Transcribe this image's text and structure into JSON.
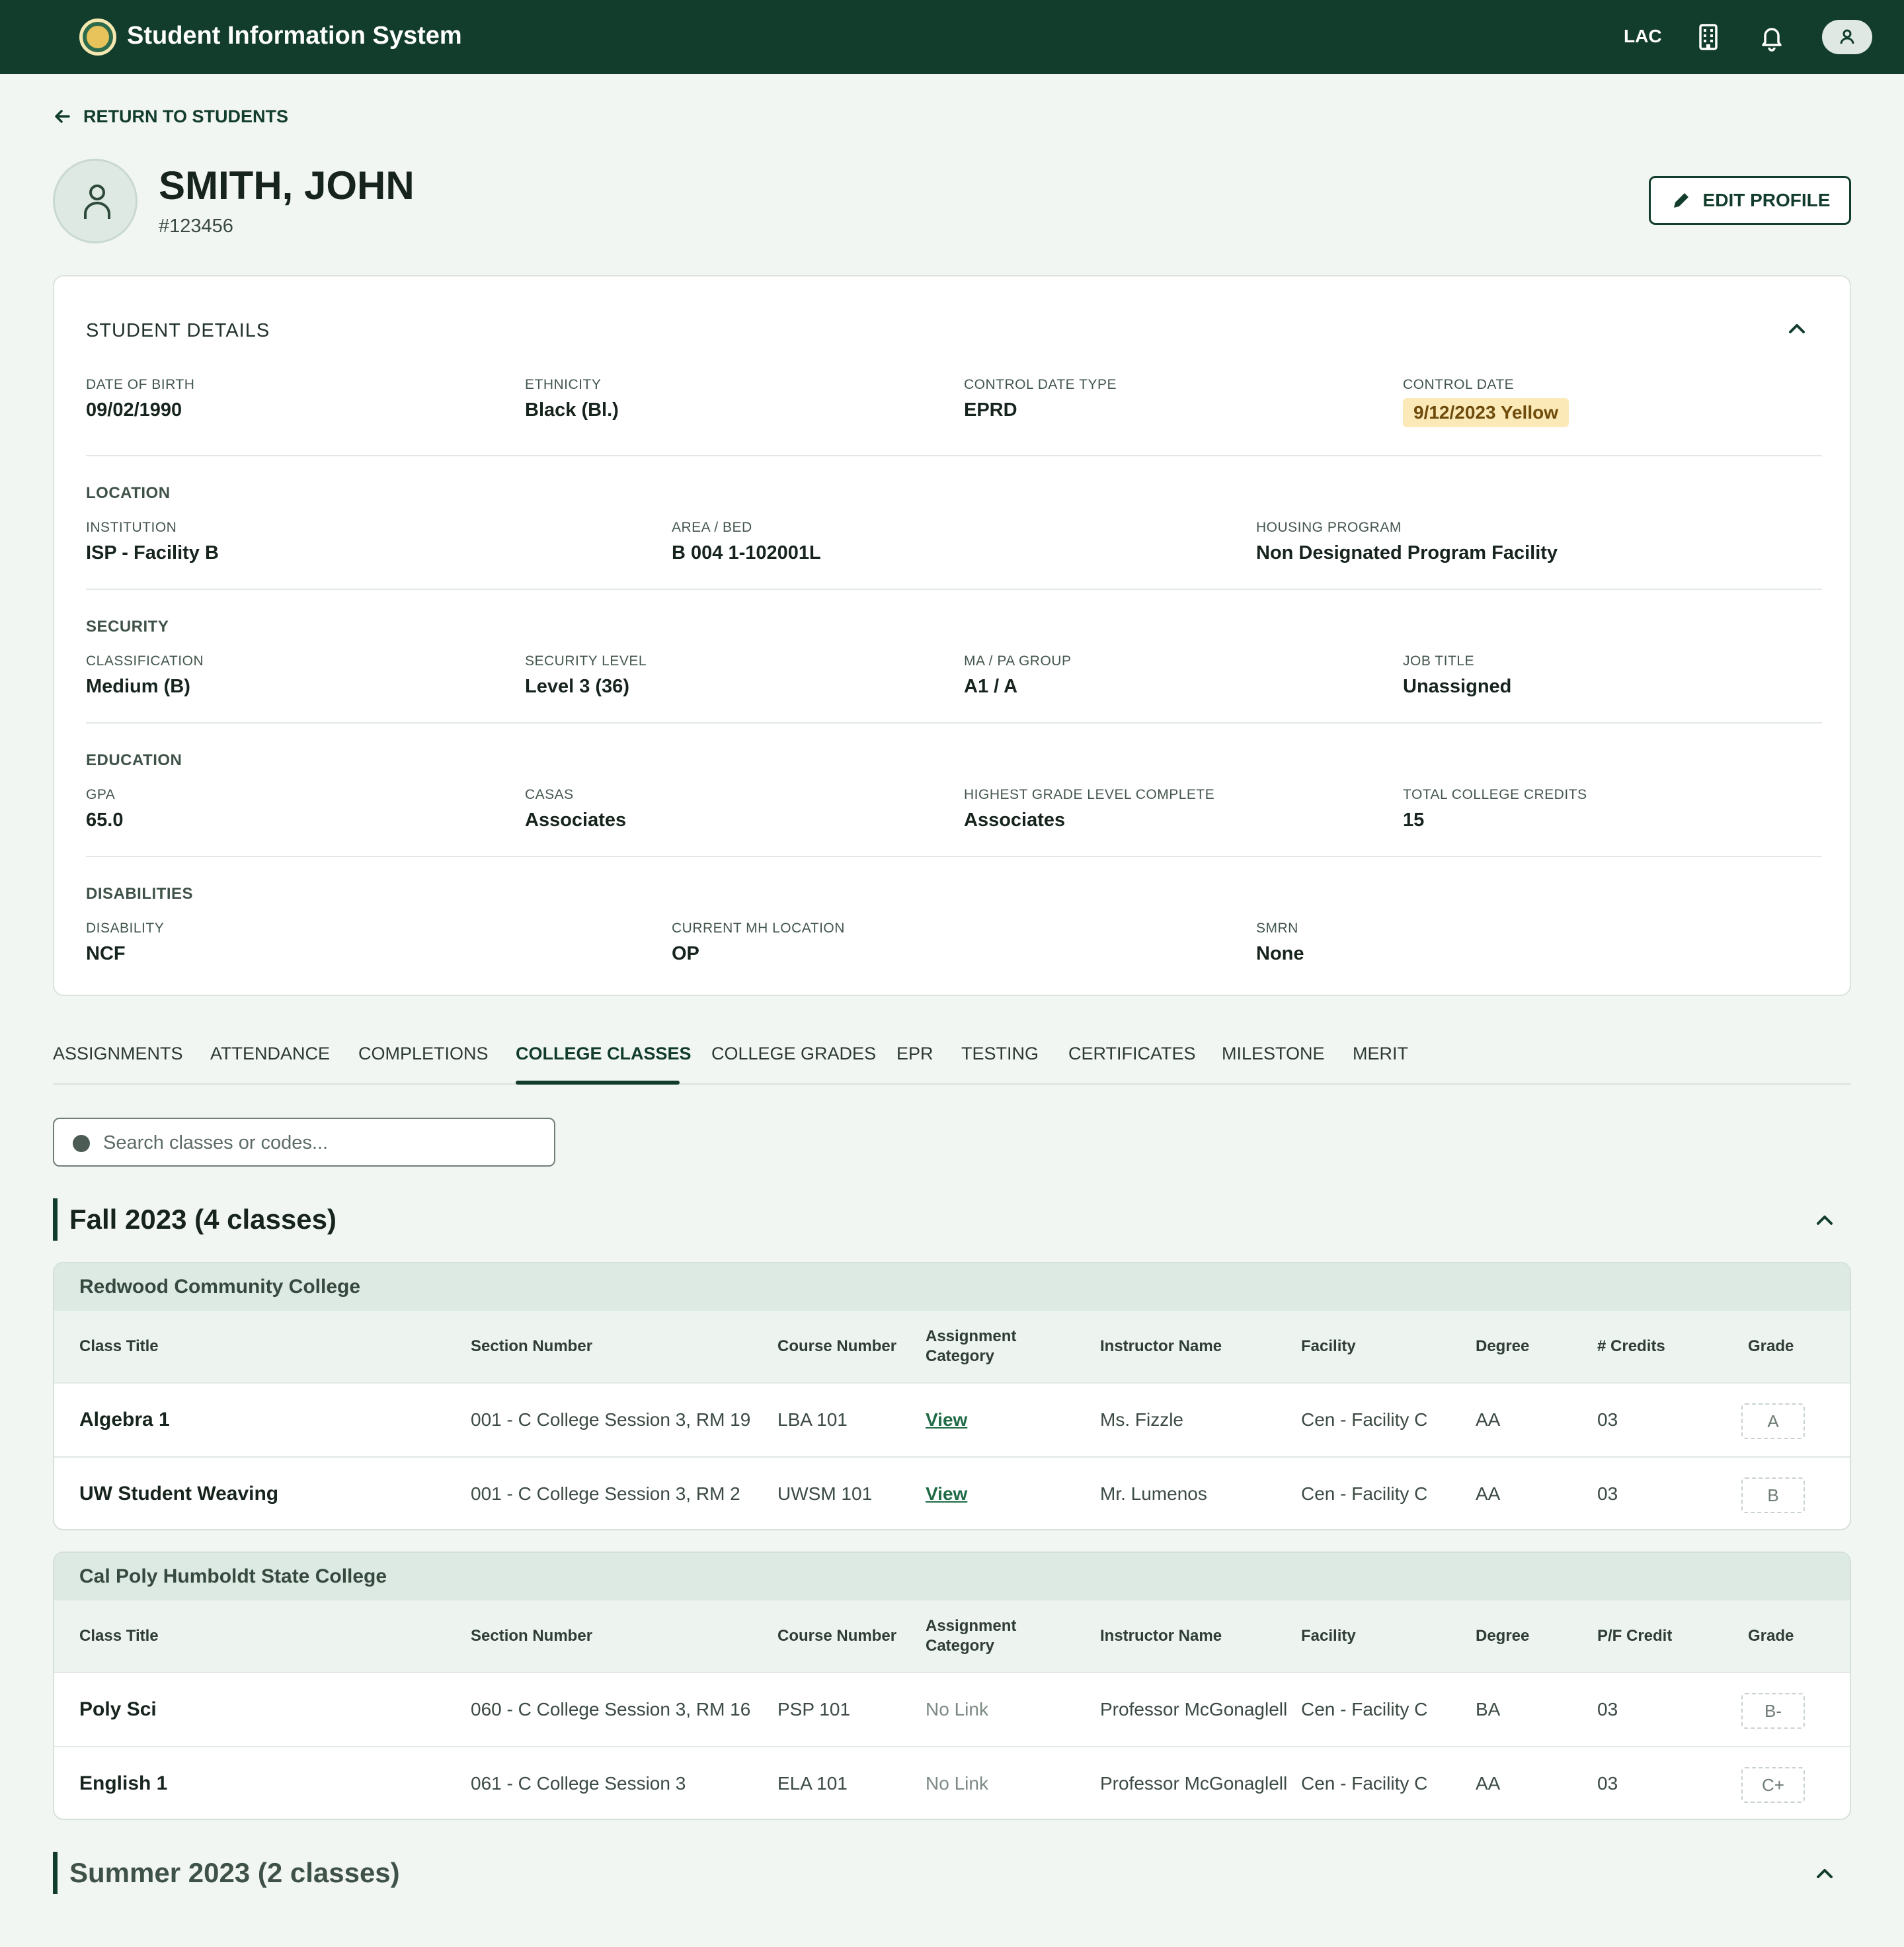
{
  "header": {
    "app_title": "Student Information System",
    "site_code": "LAC"
  },
  "nav": {
    "return_label": "RETURN TO STUDENTS"
  },
  "student": {
    "name": "SMITH, JOHN",
    "id": "#123456",
    "edit_label": "EDIT PROFILE"
  },
  "details": {
    "title": "STUDENT DETAILS",
    "general": [
      {
        "label": "DATE OF BIRTH",
        "value": "09/02/1990"
      },
      {
        "label": "ETHNICITY",
        "value": "Black (Bl.)"
      },
      {
        "label": "CONTROL DATE TYPE",
        "value": "EPRD"
      },
      {
        "label": "CONTROL DATE",
        "value": "9/12/2023 Yellow"
      }
    ],
    "location": {
      "title": "LOCATION",
      "fields": [
        {
          "label": "INSTITUTION",
          "value": "ISP - Facility B"
        },
        {
          "label": "AREA / BED",
          "value": "B 004 1-102001L"
        },
        {
          "label": "HOUSING PROGRAM",
          "value": "Non Designated Program Facility"
        }
      ]
    },
    "security": {
      "title": "SECURITY",
      "fields": [
        {
          "label": "CLASSIFICATION",
          "value": "Medium (B)"
        },
        {
          "label": "SECURITY LEVEL",
          "value": "Level 3 (36)"
        },
        {
          "label": "MA / PA GROUP",
          "value": "A1 / A"
        },
        {
          "label": "JOB TITLE",
          "value": "Unassigned"
        }
      ]
    },
    "education": {
      "title": "EDUCATION",
      "fields": [
        {
          "label": "GPA",
          "value": "65.0"
        },
        {
          "label": "CASAS",
          "value": "Associates"
        },
        {
          "label": "HIGHEST GRADE LEVEL COMPLETE",
          "value": "Associates"
        },
        {
          "label": "TOTAL COLLEGE CREDITS",
          "value": "15"
        }
      ]
    },
    "disabilities": {
      "title": "DISABILITIES",
      "fields": [
        {
          "label": "DISABILITY",
          "value": "NCF"
        },
        {
          "label": "CURRENT MH LOCATION",
          "value": "OP"
        },
        {
          "label": "SMRN",
          "value": "None"
        }
      ]
    }
  },
  "tabs": [
    "ASSIGNMENTS",
    "ATTENDANCE",
    "COMPLETIONS",
    "COLLEGE CLASSES",
    "COLLEGE GRADES",
    "EPR",
    "TESTING",
    "CERTIFICATES",
    "MILESTONE",
    "MERIT"
  ],
  "active_tab": "COLLEGE CLASSES",
  "search": {
    "placeholder": "Search classes or codes..."
  },
  "terms": [
    {
      "title": "Fall 2023 (4 classes)",
      "colleges": [
        {
          "name": "Redwood Community College",
          "headers": [
            "Class Title",
            "Section Number",
            "Course Number",
            "Assignment Category",
            "Instructor Name",
            "Facility",
            "Degree",
            "# Credits",
            "Grade"
          ],
          "rows": [
            {
              "title": "Algebra 1",
              "section": "001 - C College Session 3, RM 19",
              "course": "LBA 101",
              "assignment": "View",
              "instructor": "Ms. Fizzle",
              "facility": "Cen - Facility C",
              "degree": "AA",
              "credits": "03",
              "grade": "A"
            },
            {
              "title": "UW Student Weaving",
              "section": "001 - C College Session 3, RM 2",
              "course": "UWSM 101",
              "assignment": "View",
              "instructor": "Mr. Lumenos",
              "facility": "Cen - Facility C",
              "degree": "AA",
              "credits": "03",
              "grade": "B"
            }
          ]
        },
        {
          "name": "Cal Poly Humboldt State College",
          "headers": [
            "Class Title",
            "Section Number",
            "Course Number",
            "Assignment Category",
            "Instructor Name",
            "Facility",
            "Degree",
            "P/F Credit",
            "Grade"
          ],
          "rows": [
            {
              "title": "Poly Sci",
              "section": "060 - C College Session 3, RM 16",
              "course": "PSP 101",
              "assignment": "No Link",
              "instructor": "Professor McGonaglell",
              "facility": "Cen - Facility C",
              "degree": "BA",
              "credits": "03",
              "grade": "B-"
            },
            {
              "title": "English 1",
              "section": "061 - C College Session 3",
              "course": "ELA 101",
              "assignment": "No Link",
              "instructor": "Professor McGonaglell",
              "facility": "Cen - Facility C",
              "degree": "AA",
              "credits": "03",
              "grade": "C+"
            }
          ]
        }
      ]
    },
    {
      "title": "Summer 2023 (2 classes)"
    }
  ],
  "colors": {
    "primary": "#123d2c",
    "background": "#f2f6f3",
    "link": "#1f6b45",
    "badge_yellow": "#fbeab8"
  },
  "icons": [
    "logo-seal-icon",
    "building-icon",
    "bell-icon",
    "user-icon",
    "arrow-left-icon",
    "pencil-icon",
    "chevron-up-icon",
    "search-icon"
  ]
}
